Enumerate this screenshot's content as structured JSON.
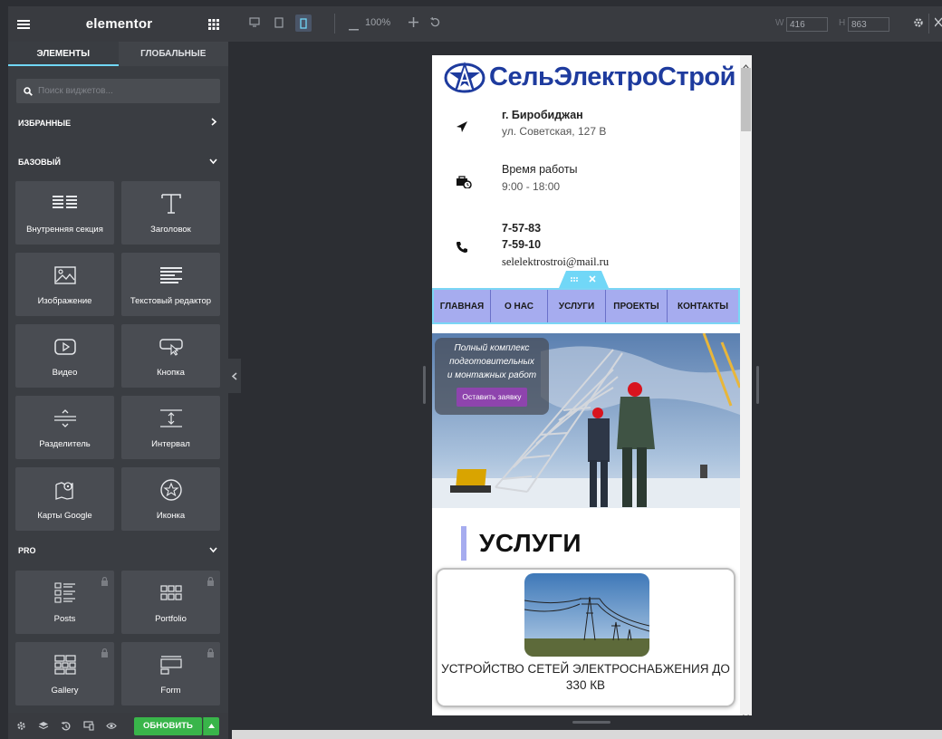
{
  "panel": {
    "title": "elementor",
    "tabs": [
      "ЭЛЕМЕНТЫ",
      "ГЛОБАЛЬНЫЕ"
    ],
    "search_placeholder": "Поиск виджетов...",
    "categories": {
      "favorites": "ИЗБРАННЫЕ",
      "basic": "БАЗОВЫЙ",
      "pro": "PRO"
    },
    "basic_widgets": [
      {
        "label": "Внутренняя секция",
        "icon": "inner-section-icon"
      },
      {
        "label": "Заголовок",
        "icon": "heading-icon"
      },
      {
        "label": "Изображение",
        "icon": "image-icon"
      },
      {
        "label": "Текстовый редактор",
        "icon": "text-editor-icon"
      },
      {
        "label": "Видео",
        "icon": "video-icon"
      },
      {
        "label": "Кнопка",
        "icon": "button-icon"
      },
      {
        "label": "Разделитель",
        "icon": "divider-icon"
      },
      {
        "label": "Интервал",
        "icon": "spacer-icon"
      },
      {
        "label": "Карты Google",
        "icon": "google-maps-icon"
      },
      {
        "label": "Иконка",
        "icon": "star-icon"
      }
    ],
    "pro_widgets": [
      {
        "label": "Posts",
        "icon": "posts-icon"
      },
      {
        "label": "Portfolio",
        "icon": "portfolio-icon"
      },
      {
        "label": "Gallery",
        "icon": "gallery-icon"
      },
      {
        "label": "Form",
        "icon": "form-icon"
      }
    ],
    "footer": {
      "update_label": "ОБНОВИТЬ"
    }
  },
  "topbar": {
    "zoom": "100%",
    "width_label": "W",
    "width_value": "416",
    "height_label": "H",
    "height_value": "863"
  },
  "site": {
    "logo_text": "СельЭлектроСтрой",
    "address": {
      "title": "г. Биробиджан",
      "text": "ул. Советская, 127 В"
    },
    "hours": {
      "title": "Время работы",
      "text": "9:00 - 18:00"
    },
    "contacts": {
      "phone1": "7-57-83",
      "phone2": "7-59-10",
      "email": "selelektrostroi@mail.ru"
    },
    "menu": [
      "ГЛАВНАЯ",
      "О НАС",
      "УСЛУГИ",
      "ПРОЕКТЫ",
      "КОНТАКТЫ"
    ],
    "hero": {
      "line1": "Полный комплекс",
      "line2": "подготовительных",
      "line3": "и монтажных работ",
      "button": "Оставить заявку"
    },
    "services_title": "УСЛУГИ",
    "service_card": "УСТРОЙСТВО СЕТЕЙ ЭЛЕКТРОСНАБЖЕНИЯ ДО 330 КВ"
  },
  "colors": {
    "panel_bg": "#3a3d42",
    "accent_tab": "#71d7f7",
    "update_green": "#39b54a",
    "menu_bg": "#a6acef",
    "logo_blue": "#1e3b9e",
    "hero_button": "#8e44ad"
  }
}
